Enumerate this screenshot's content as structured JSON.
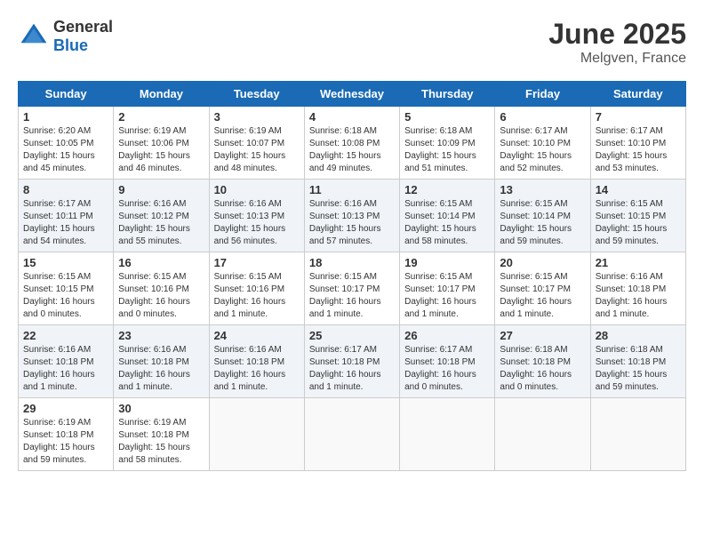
{
  "header": {
    "logo_general": "General",
    "logo_blue": "Blue",
    "title": "June 2025",
    "subtitle": "Melgven, France"
  },
  "calendar": {
    "headers": [
      "Sunday",
      "Monday",
      "Tuesday",
      "Wednesday",
      "Thursday",
      "Friday",
      "Saturday"
    ],
    "weeks": [
      [
        {
          "day": "1",
          "info": "Sunrise: 6:20 AM\nSunset: 10:05 PM\nDaylight: 15 hours and 45 minutes."
        },
        {
          "day": "2",
          "info": "Sunrise: 6:19 AM\nSunset: 10:06 PM\nDaylight: 15 hours and 46 minutes."
        },
        {
          "day": "3",
          "info": "Sunrise: 6:19 AM\nSunset: 10:07 PM\nDaylight: 15 hours and 48 minutes."
        },
        {
          "day": "4",
          "info": "Sunrise: 6:18 AM\nSunset: 10:08 PM\nDaylight: 15 hours and 49 minutes."
        },
        {
          "day": "5",
          "info": "Sunrise: 6:18 AM\nSunset: 10:09 PM\nDaylight: 15 hours and 51 minutes."
        },
        {
          "day": "6",
          "info": "Sunrise: 6:17 AM\nSunset: 10:10 PM\nDaylight: 15 hours and 52 minutes."
        },
        {
          "day": "7",
          "info": "Sunrise: 6:17 AM\nSunset: 10:10 PM\nDaylight: 15 hours and 53 minutes."
        }
      ],
      [
        {
          "day": "8",
          "info": "Sunrise: 6:17 AM\nSunset: 10:11 PM\nDaylight: 15 hours and 54 minutes."
        },
        {
          "day": "9",
          "info": "Sunrise: 6:16 AM\nSunset: 10:12 PM\nDaylight: 15 hours and 55 minutes."
        },
        {
          "day": "10",
          "info": "Sunrise: 6:16 AM\nSunset: 10:13 PM\nDaylight: 15 hours and 56 minutes."
        },
        {
          "day": "11",
          "info": "Sunrise: 6:16 AM\nSunset: 10:13 PM\nDaylight: 15 hours and 57 minutes."
        },
        {
          "day": "12",
          "info": "Sunrise: 6:15 AM\nSunset: 10:14 PM\nDaylight: 15 hours and 58 minutes."
        },
        {
          "day": "13",
          "info": "Sunrise: 6:15 AM\nSunset: 10:14 PM\nDaylight: 15 hours and 59 minutes."
        },
        {
          "day": "14",
          "info": "Sunrise: 6:15 AM\nSunset: 10:15 PM\nDaylight: 15 hours and 59 minutes."
        }
      ],
      [
        {
          "day": "15",
          "info": "Sunrise: 6:15 AM\nSunset: 10:15 PM\nDaylight: 16 hours and 0 minutes."
        },
        {
          "day": "16",
          "info": "Sunrise: 6:15 AM\nSunset: 10:16 PM\nDaylight: 16 hours and 0 minutes."
        },
        {
          "day": "17",
          "info": "Sunrise: 6:15 AM\nSunset: 10:16 PM\nDaylight: 16 hours and 1 minute."
        },
        {
          "day": "18",
          "info": "Sunrise: 6:15 AM\nSunset: 10:17 PM\nDaylight: 16 hours and 1 minute."
        },
        {
          "day": "19",
          "info": "Sunrise: 6:15 AM\nSunset: 10:17 PM\nDaylight: 16 hours and 1 minute."
        },
        {
          "day": "20",
          "info": "Sunrise: 6:15 AM\nSunset: 10:17 PM\nDaylight: 16 hours and 1 minute."
        },
        {
          "day": "21",
          "info": "Sunrise: 6:16 AM\nSunset: 10:18 PM\nDaylight: 16 hours and 1 minute."
        }
      ],
      [
        {
          "day": "22",
          "info": "Sunrise: 6:16 AM\nSunset: 10:18 PM\nDaylight: 16 hours and 1 minute."
        },
        {
          "day": "23",
          "info": "Sunrise: 6:16 AM\nSunset: 10:18 PM\nDaylight: 16 hours and 1 minute."
        },
        {
          "day": "24",
          "info": "Sunrise: 6:16 AM\nSunset: 10:18 PM\nDaylight: 16 hours and 1 minute."
        },
        {
          "day": "25",
          "info": "Sunrise: 6:17 AM\nSunset: 10:18 PM\nDaylight: 16 hours and 1 minute."
        },
        {
          "day": "26",
          "info": "Sunrise: 6:17 AM\nSunset: 10:18 PM\nDaylight: 16 hours and 0 minutes."
        },
        {
          "day": "27",
          "info": "Sunrise: 6:18 AM\nSunset: 10:18 PM\nDaylight: 16 hours and 0 minutes."
        },
        {
          "day": "28",
          "info": "Sunrise: 6:18 AM\nSunset: 10:18 PM\nDaylight: 15 hours and 59 minutes."
        }
      ],
      [
        {
          "day": "29",
          "info": "Sunrise: 6:19 AM\nSunset: 10:18 PM\nDaylight: 15 hours and 59 minutes."
        },
        {
          "day": "30",
          "info": "Sunrise: 6:19 AM\nSunset: 10:18 PM\nDaylight: 15 hours and 58 minutes."
        },
        {
          "day": "",
          "info": ""
        },
        {
          "day": "",
          "info": ""
        },
        {
          "day": "",
          "info": ""
        },
        {
          "day": "",
          "info": ""
        },
        {
          "day": "",
          "info": ""
        }
      ]
    ]
  }
}
